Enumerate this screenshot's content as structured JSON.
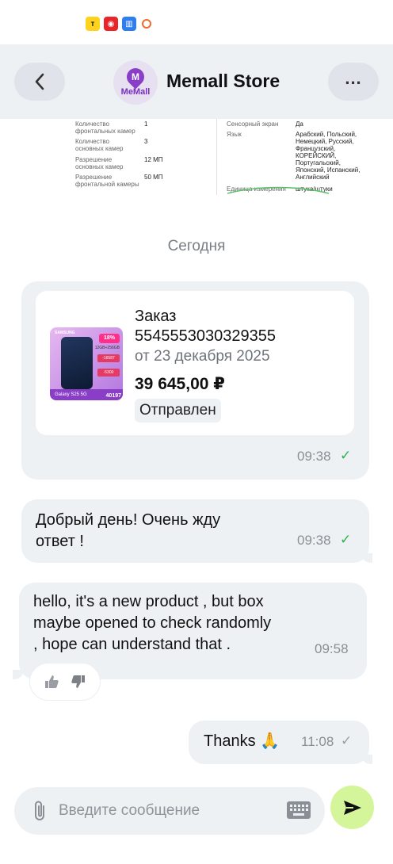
{
  "status_bar": {
    "icons": [
      "yandex-icon",
      "red-app-icon",
      "blue-app-icon",
      "ring-icon"
    ]
  },
  "header": {
    "store_name": "Memall Store",
    "avatar_brand": "MeMall",
    "avatar_letter": "M",
    "more_label": "..."
  },
  "spec": {
    "left": [
      {
        "label": "Количество фронтальных камер",
        "value": "1"
      },
      {
        "label": "Количество основных камер",
        "value": "3"
      },
      {
        "label": "Разрешение основных камер",
        "value": "12 МП"
      },
      {
        "label": "Разрешение фронтальной камеры",
        "value": "50 МП"
      }
    ],
    "right": [
      {
        "label": "Сенсорный экран",
        "value": "Да"
      },
      {
        "label": "Язык",
        "value": "Арабский, Польский, Немецкий, Русский, Французский, КОРЕЙСКИЙ, Португальский, Японский, Испанский, Английский"
      },
      {
        "label": "Единица измерения",
        "value": "штука/штуки"
      }
    ]
  },
  "date_separator": "Сегодня",
  "order": {
    "title": "Заказ 5545553030329355",
    "date": "от 23 декабря 2025",
    "price": "39 645,00 ₽",
    "status": "Отправлен",
    "time": "09:38",
    "image": {
      "brand": "SAMSUNG",
      "discount": "18%",
      "memory": "12GB+256GB",
      "promo1": "-16587",
      "promo2": "-5300",
      "model": "Galaxy S25 5G",
      "price": "40197"
    }
  },
  "messages": [
    {
      "text_line1": "Добрый день! Очень жду",
      "text_line2": "ответ !",
      "time": "09:38",
      "status": "read"
    },
    {
      "text_line1": "hello, it's a new product , but box",
      "text_line2": "maybe opened to check randomly",
      "text_line3": ", hope can understand that .",
      "time": "09:58"
    },
    {
      "text": "Thanks 🙏",
      "time": "11:08",
      "status": "sent"
    }
  ],
  "input": {
    "placeholder": "Введите сообщение"
  },
  "colors": {
    "accent_send": "#d4f59a",
    "bubble_bg": "#eef1f4",
    "check_green": "#2bb24c",
    "brand_purple": "#8a3ec8"
  }
}
